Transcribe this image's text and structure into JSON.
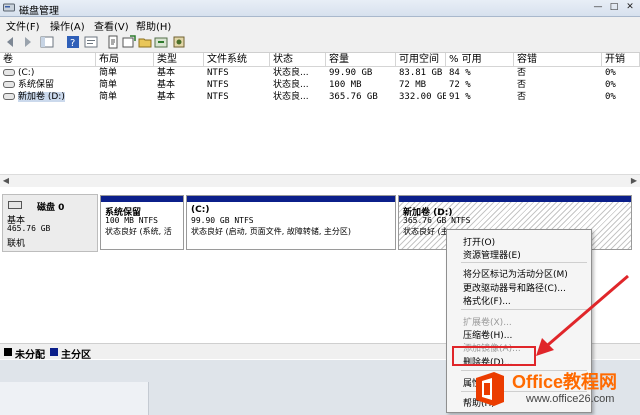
{
  "window": {
    "title": "磁盘管理",
    "min": "—",
    "max": "□",
    "close": "✕"
  },
  "menu": [
    "文件(F)",
    "操作(A)",
    "查看(V)",
    "帮助(H)"
  ],
  "toolbar_icons": [
    "back-icon",
    "forward-icon",
    "console-tree-icon",
    "help-icon",
    "properties-icon",
    "refresh-icon",
    "new-volume-icon",
    "folder-icon",
    "rescan-icon",
    "settings-icon"
  ],
  "columns": [
    "卷",
    "布局",
    "类型",
    "文件系统",
    "状态",
    "容量",
    "可用空间",
    "% 可用",
    "容错",
    "开销"
  ],
  "volumes": [
    {
      "name": "(C:)",
      "layout": "简单",
      "type": "基本",
      "fs": "NTFS",
      "status": "状态良...",
      "capacity": "99.90 GB",
      "free": "83.81 GB",
      "pct": "84 %",
      "fault": "否",
      "overhead": "0%"
    },
    {
      "name": "系统保留",
      "layout": "简单",
      "type": "基本",
      "fs": "NTFS",
      "status": "状态良...",
      "capacity": "100 MB",
      "free": "72 MB",
      "pct": "72 %",
      "fault": "否",
      "overhead": "0%"
    },
    {
      "name": "新加卷 (D:)",
      "layout": "简单",
      "type": "基本",
      "fs": "NTFS",
      "status": "状态良...",
      "capacity": "365.76 GB",
      "free": "332.00 GB",
      "pct": "91 %",
      "fault": "否",
      "overhead": "0%"
    }
  ],
  "disk": {
    "label": "磁盘 0",
    "type": "基本",
    "size": "465.76 GB",
    "state": "联机"
  },
  "partitions": [
    {
      "name": "系统保留",
      "size": "100 MB NTFS",
      "status": "状态良好 (系统, 活"
    },
    {
      "name": "(C:)",
      "size": "99.90 GB NTFS",
      "status": "状态良好 (启动, 页面文件, 故障转储, 主分区)"
    },
    {
      "name": "新加卷 (D:)",
      "size": "365.76 GB NTFS",
      "status": "状态良好 (主"
    }
  ],
  "legend": [
    "未分配",
    "主分区"
  ],
  "legend_colors": {
    "unallocated": "#000000",
    "primary": "#0b1f8a"
  },
  "context_menu": [
    {
      "label": "打开(O)",
      "enabled": true
    },
    {
      "label": "资源管理器(E)",
      "enabled": true
    },
    {
      "label": "将分区标记为活动分区(M)",
      "enabled": true
    },
    {
      "label": "更改驱动器号和路径(C)...",
      "enabled": true
    },
    {
      "label": "格式化(F)...",
      "enabled": true
    },
    {
      "label": "扩展卷(X)...",
      "enabled": false
    },
    {
      "label": "压缩卷(H)...",
      "enabled": true
    },
    {
      "label": "添加镜像(A)...",
      "enabled": false
    },
    {
      "label": "删除卷(D)...",
      "enabled": true
    },
    {
      "label": "属性(P)",
      "enabled": true
    },
    {
      "label": "帮助(H)",
      "enabled": true
    }
  ],
  "watermark": {
    "title": "Office教程网",
    "url": "www.office26.com"
  },
  "colors": {
    "highlight": "#e0262a",
    "selection": "#cbd9ec"
  }
}
